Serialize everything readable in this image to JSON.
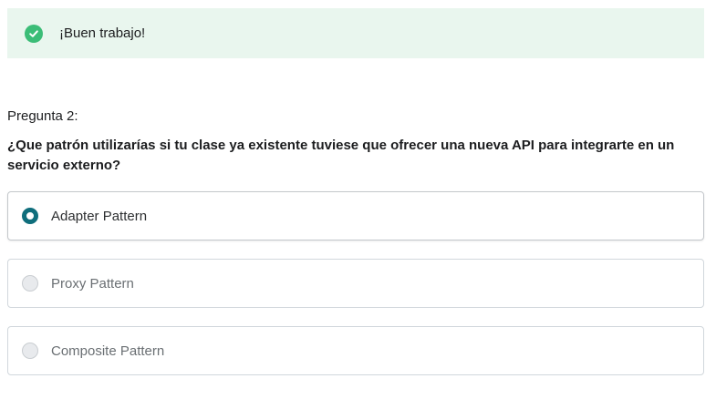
{
  "alert": {
    "icon": "check-circle-icon",
    "color": "#3bbd77",
    "background": "#e9f6ee",
    "message": "¡Buen trabajo!"
  },
  "question": {
    "number_label": "Pregunta 2:",
    "text": "¿Que patrón utilizarías si tu clase ya existente tuviese que ofrecer una nueva API para integrarte en un servicio externo?"
  },
  "options": [
    {
      "label": "Adapter Pattern",
      "selected": true
    },
    {
      "label": "Proxy Pattern",
      "selected": false
    },
    {
      "label": "Composite Pattern",
      "selected": false
    }
  ],
  "accent_color": "#0f6e7c"
}
